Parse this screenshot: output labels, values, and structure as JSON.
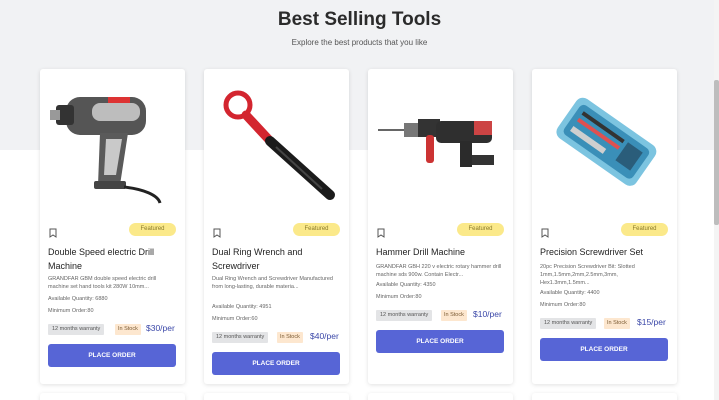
{
  "header": {
    "title": "Best Selling Tools",
    "subtitle": "Explore the best products that you like"
  },
  "colors": {
    "accent": "#5765d6",
    "featured": "#fbe98a",
    "in_stock": "#fde7cf",
    "price": "#3a47a8"
  },
  "products": [
    {
      "featured": "Featured",
      "title": "Double Speed electric Drill Machine",
      "description": "GRANDFAR GBM double speed electric drill machine set hand tools kit 280W 10mm...",
      "quantity": "Available Quantity: 6880",
      "min_order": "Minimum Order:80",
      "warranty": "12 months warranty",
      "stock": "In Stock",
      "price": "$30/per",
      "button": "PLACE ORDER",
      "icon": "drill-image"
    },
    {
      "featured": "Featured",
      "title": "Dual Ring Wrench and Screwdriver",
      "description": "Dual Ring Wrench and Screwdriver Manufactured from long-lasting, durable materia...",
      "quantity": "Available Quantity: 4951",
      "min_order": "Minimum Order:60",
      "warranty": "12 months warranty",
      "stock": "In Stock",
      "price": "$40/per",
      "button": "PLACE ORDER",
      "icon": "wrench-image"
    },
    {
      "featured": "Featured",
      "title": "Hammer Drill Machine",
      "description": "GRANDFAR GBH 220 v electric rotary hammer drill machine sds 900w. Contain Electr...",
      "quantity": "Available Quantity: 4350",
      "min_order": "Minimum Order:80",
      "warranty": "12 months warranty",
      "stock": "In Stock",
      "price": "$10/per",
      "button": "PLACE ORDER",
      "icon": "hammer-drill-image"
    },
    {
      "featured": "Featured",
      "title": "Precision Screwdriver Set",
      "description": "20pc Precision Screwdriver Bit: Slotted 1mm,1.5mm,2mm,2.5mm,3mm, Hex1.3mm,1.5mm...",
      "quantity": "Available Quantity: 4400",
      "min_order": "Minimum Order:80",
      "warranty": "12 months warranty",
      "stock": "In Stock",
      "price": "$15/per",
      "button": "PLACE ORDER",
      "icon": "screwdriver-set-image"
    }
  ]
}
